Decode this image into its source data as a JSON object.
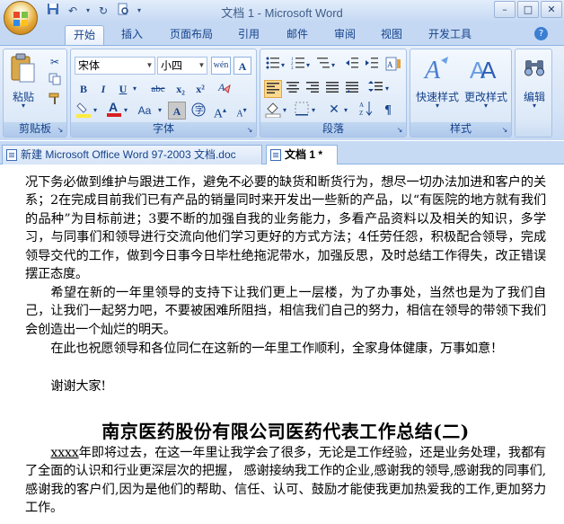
{
  "window": {
    "title": "文档 1 - Microsoft Word",
    "controls": [
      "–",
      "□",
      "✕"
    ]
  },
  "quick_access": [
    "save",
    "undo",
    "redo",
    "print-preview",
    "customize"
  ],
  "tabs": [
    "开始",
    "插入",
    "页面布局",
    "引用",
    "邮件",
    "审阅",
    "视图",
    "开发工具"
  ],
  "active_tab": "开始",
  "ribbon": {
    "clipboard": {
      "label": "剪贴板",
      "paste": "粘贴"
    },
    "font": {
      "label": "字体",
      "font_name": "宋体",
      "font_size": "小四",
      "wen": "wén",
      "A_box": "A",
      "bold": "B",
      "italic": "I",
      "underline": "U",
      "strike": "abc",
      "sub": "x₂",
      "sup": "x²",
      "aa": "Aa",
      "char_border": "A"
    },
    "paragraph": {
      "label": "段落"
    },
    "styles": {
      "label": "样式",
      "quick_styles": "快速样式",
      "change_styles": "更改样式"
    },
    "editing": {
      "label": "编辑"
    }
  },
  "doc_tabs": [
    {
      "label": "新建 Microsoft Office Word 97-2003 文档.doc",
      "active": false
    },
    {
      "label": "文档 1 *",
      "active": true
    }
  ],
  "document": {
    "para1": "况下务必做到维护与跟进工作，避免不必要的缺货和断货行为，想尽一切办法加进和客户的关系；2在完成目前我们已有产品的销量同时来开发出一些新的产品，以“有医院的地方就有我们的品种”为目标前进；3要不断的加强自我的业务能力，多看产品资料以及相关的知识，多学习，与同事们和领导进行交流向他们学习更好的方式方法；4任劳任怨，积极配合领导，完成领导交代的工作，做到今日事今日毕杜绝拖泥带水，加强反思，及时总结工作得失，改正错误摆正态度。",
    "para2": "希望在新的一年里领导的支持下让我们更上一层楼，为了办事处，当然也是为了我们自己，让我们一起努力吧，不要被困难所阻挡，相信我们自己的努力，相信在领导的带领下我们会创造出一个灿烂的明天。",
    "para3": "在此也祝愿领导和各位同仁在这新的一年里工作顺利，全家身体健康，万事如意！",
    "para4": "谢谢大家!",
    "heading": "南京医药股份有限公司医药代表工作总结(二)",
    "para5_prefix": "xxxx",
    "para5_rest": "年即将过去，在这一年里让我学会了很多，无论是工作经验，还是业务处理，我都有了全面的认识和行业更深层次的把握，  感谢接纳我工作的企业,感谢我的领导,感谢我的同事们,感谢我的客户们,因为是他们的帮助、信任、认可、鼓励才能使我更加热爱我的工作,更加努力工作。"
  },
  "colors": {
    "ribbon_text": "#15428b",
    "font_color_red": "#d82020",
    "highlight_yellow": "#ffeb3b"
  }
}
